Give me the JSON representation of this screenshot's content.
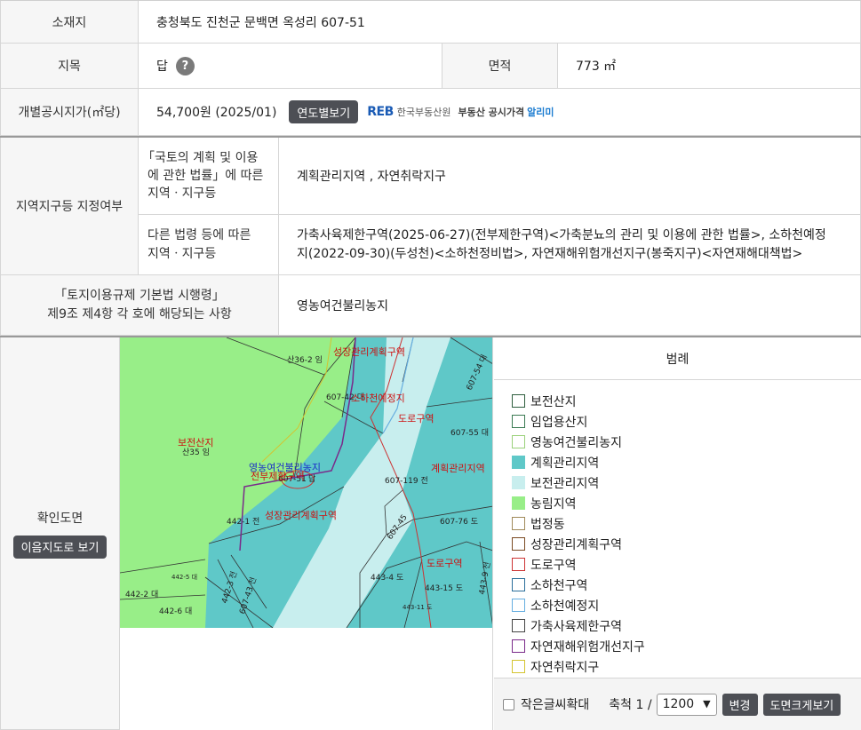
{
  "location": {
    "label": "소재지",
    "value": "충청북도 진천군 문백면 옥성리 607-51"
  },
  "land_category": {
    "label": "지목",
    "value": "답",
    "help_icon": "question-icon"
  },
  "area": {
    "label": "면적",
    "value": "773 ㎡"
  },
  "official_price": {
    "label": "개별공시지가(㎡당)",
    "value": "54,700원 (2025/01)",
    "button": "연도별보기",
    "reb_mark": "REB",
    "reb_org": "한국부동산원",
    "reb_service": "부동산 공시가격",
    "reb_highlight": "알리미"
  },
  "zoning": {
    "label": "지역지구등 지정여부",
    "row1_label_l1": "「국토의 계획 및 이용",
    "row1_label_l2": "에 관한 법률」에 따른",
    "row1_label_l3": "지역ㆍ지구등",
    "row1_value": "계획관리지역 , 자연취락지구",
    "row2_label_l1": "다른 법령 등에 따른",
    "row2_label_l2": "지역ㆍ지구등",
    "row2_value_l1": "가축사육제한구역(2025-06-27)(전부제한구역)<가축분뇨의 관리 및 이용에 관한 법률>, 소하천예정",
    "row2_value_l2": "지(2022-09-30)(두성천)<소하천정비법>, 자연재해위험개선지구(봉죽지구)<자연재해대책법>"
  },
  "enforcement": {
    "label_l1": "「토지이용규제 기본법 시행령」",
    "label_l2": "제9조 제4항 각 호에 해당되는 사항",
    "value": "영농여건불리농지"
  },
  "map_section": {
    "label": "확인도면",
    "button": "이음지도로 보기"
  },
  "map_labels": {
    "lot_main": "607-51",
    "lot_main_suffix": "답",
    "lot_san36": "산36-2 임",
    "lot_san35": "산35 임",
    "lot_607_42": "607-42 대",
    "lot_607_54": "607-54 대",
    "lot_607_55": "607-55 대",
    "lot_607_119": "607-119 전",
    "lot_607_76": "607-76 도",
    "lot_607_43": "607-43 전",
    "lot_607_45": "607-45",
    "lot_442_1": "442-1 전",
    "lot_442_2": "442-2 대",
    "lot_442_6": "442-6 대",
    "lot_442_5": "442-5 대",
    "lot_442_3": "442-3 전",
    "lot_443_4": "443-4 도",
    "lot_443_15": "443-15 도",
    "lot_443_11": "443-11 도",
    "lot_443_9": "443-9 전",
    "zone_forest": "보전산지",
    "zone_growth_top": "성장관리계획구역",
    "zone_growth_mid": "성장관리계획구역",
    "zone_stream": "소하천예정지",
    "zone_road_top": "도로구역",
    "zone_road_bottom": "도로구역",
    "zone_plan": "계획관리지역",
    "zone_farm": "영농여건불리농지",
    "zone_livestock": "전부제한구역"
  },
  "legend": {
    "title": "범례",
    "items": [
      {
        "label": "보전산지",
        "border": "#2e5e3e",
        "fill": "#ffffff"
      },
      {
        "label": "임업용산지",
        "border": "#3a7a52",
        "fill": "#ffffff"
      },
      {
        "label": "영농여건불리농지",
        "border": "#9ad17a",
        "fill": "#ffffff"
      },
      {
        "label": "계획관리지역",
        "border": "#5fc8c8",
        "fill": "#5fc8c8"
      },
      {
        "label": "보전관리지역",
        "border": "#c8eeee",
        "fill": "#c8eeee"
      },
      {
        "label": "농림지역",
        "border": "#98ee88",
        "fill": "#98ee88"
      },
      {
        "label": "법정동",
        "border": "#a08a5a",
        "fill": "#ffffff"
      },
      {
        "label": "성장관리계획구역",
        "border": "#7a4a22",
        "fill": "#ffffff"
      },
      {
        "label": "도로구역",
        "border": "#cc3333",
        "fill": "#ffffff"
      },
      {
        "label": "소하천구역",
        "border": "#2a6e9a",
        "fill": "#ffffff"
      },
      {
        "label": "소하천예정지",
        "border": "#66aee0",
        "fill": "#ffffff"
      },
      {
        "label": "가축사육제한구역",
        "border": "#444444",
        "fill": "#ffffff"
      },
      {
        "label": "자연재해위험개선지구",
        "border": "#7a2a8a",
        "fill": "#ffffff"
      },
      {
        "label": "자연취락지구",
        "border": "#d4c430",
        "fill": "#ffffff"
      }
    ]
  },
  "map_controls": {
    "checkbox_label": "작은글씨확대",
    "scale_label": "축척 1 /",
    "scale_value": "1200",
    "change_button": "변경",
    "enlarge_button": "도면크게보기"
  }
}
